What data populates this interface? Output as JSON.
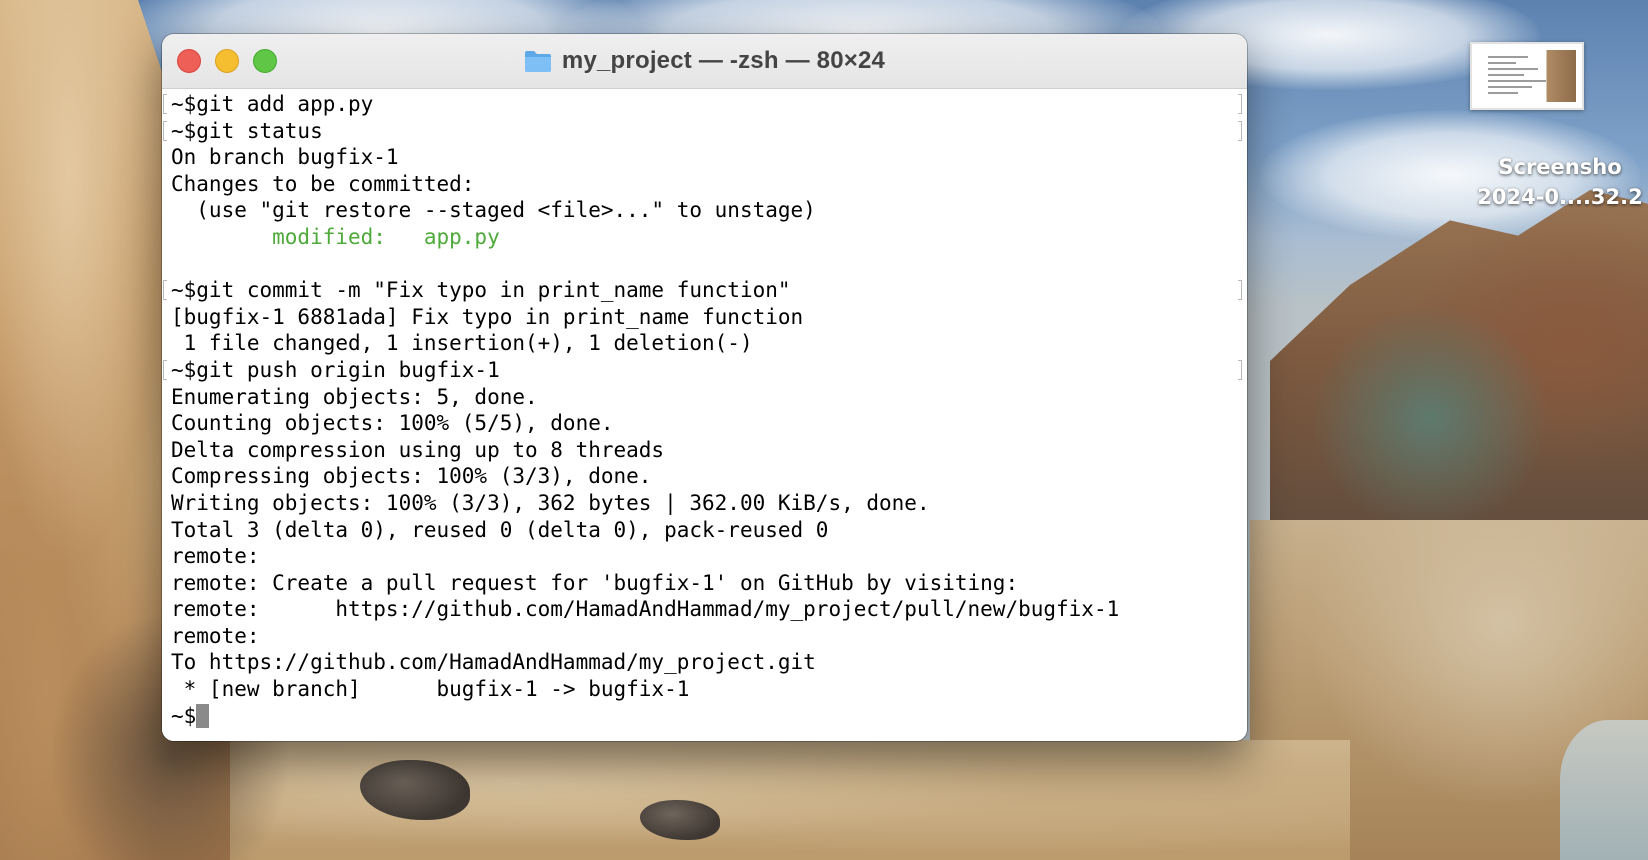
{
  "window": {
    "title": "my_project — -zsh — 80×24",
    "folder_icon": "folder-icon"
  },
  "colors": {
    "text": "#000000",
    "modified_green": "#4eaa3a",
    "cursor": "#8a8a8a",
    "close": "#ee5f57",
    "minimize": "#f5bd30",
    "zoom": "#5fc646"
  },
  "terminal": {
    "lines": [
      {
        "text": "~$git add app.py",
        "marked": true
      },
      {
        "text": "~$git status",
        "marked": true
      },
      {
        "text": "On branch bugfix-1",
        "marked": false
      },
      {
        "text": "Changes to be committed:",
        "marked": false
      },
      {
        "text": "  (use \"git restore --staged <file>...\" to unstage)",
        "marked": false
      },
      {
        "text": "        modified:   app.py",
        "marked": false,
        "color": "green"
      },
      {
        "text": "",
        "marked": false
      },
      {
        "text": "~$git commit -m \"Fix typo in print_name function\"",
        "marked": true
      },
      {
        "text": "[bugfix-1 6881ada] Fix typo in print_name function",
        "marked": false
      },
      {
        "text": " 1 file changed, 1 insertion(+), 1 deletion(-)",
        "marked": false
      },
      {
        "text": "~$git push origin bugfix-1",
        "marked": true
      },
      {
        "text": "Enumerating objects: 5, done.",
        "marked": false
      },
      {
        "text": "Counting objects: 100% (5/5), done.",
        "marked": false
      },
      {
        "text": "Delta compression using up to 8 threads",
        "marked": false
      },
      {
        "text": "Compressing objects: 100% (3/3), done.",
        "marked": false
      },
      {
        "text": "Writing objects: 100% (3/3), 362 bytes | 362.00 KiB/s, done.",
        "marked": false
      },
      {
        "text": "Total 3 (delta 0), reused 0 (delta 0), pack-reused 0",
        "marked": false
      },
      {
        "text": "remote:",
        "marked": false
      },
      {
        "text": "remote: Create a pull request for 'bugfix-1' on GitHub by visiting:",
        "marked": false
      },
      {
        "text": "remote:      https://github.com/HamadAndHammad/my_project/pull/new/bugfix-1",
        "marked": false
      },
      {
        "text": "remote:",
        "marked": false
      },
      {
        "text": "To https://github.com/HamadAndHammad/my_project.git",
        "marked": false
      },
      {
        "text": " * [new branch]      bugfix-1 -> bugfix-1",
        "marked": false
      }
    ],
    "prompt": "~$"
  },
  "desktop": {
    "file": {
      "name_line1": "Screensho",
      "name_line2": "2024-0....32.2"
    }
  }
}
